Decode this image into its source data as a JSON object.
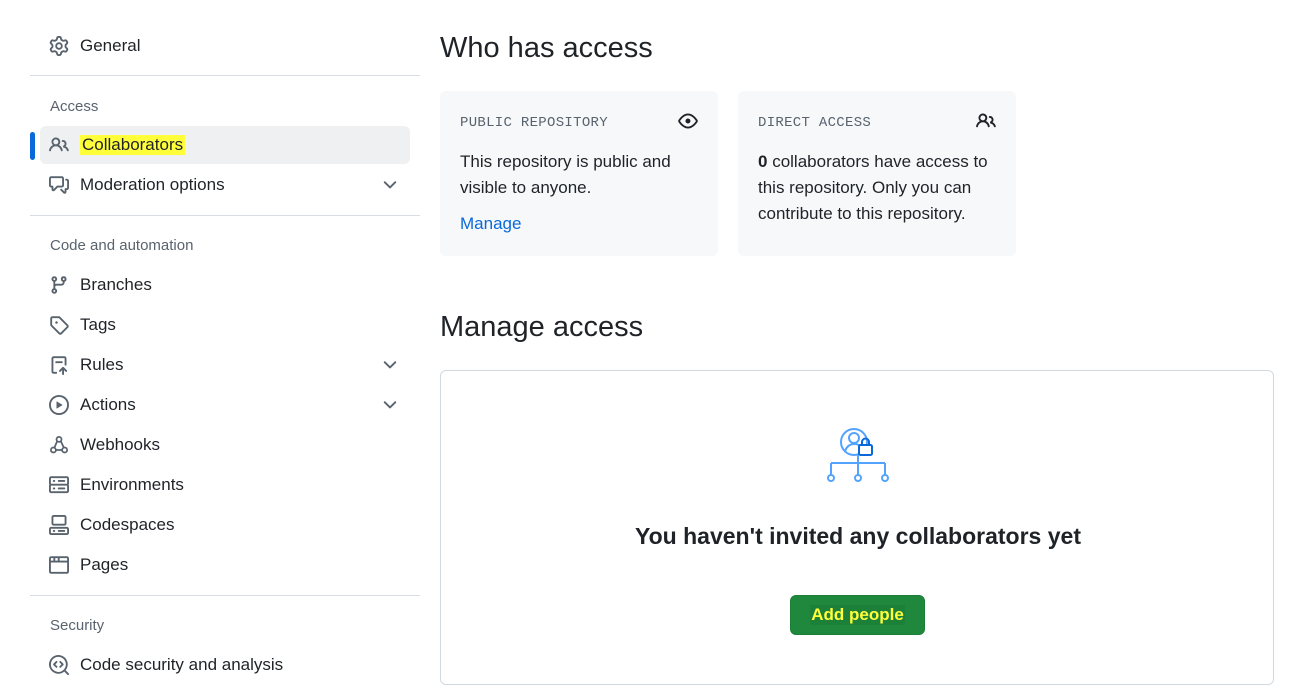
{
  "sidebar": {
    "general": "General",
    "sections": [
      {
        "label": "Access"
      },
      {
        "label": "Code and automation"
      },
      {
        "label": "Security"
      }
    ],
    "access_items": [
      {
        "label": "Collaborators",
        "icon": "people-icon"
      },
      {
        "label": "Moderation options",
        "icon": "comment-discussion-icon"
      }
    ],
    "automation_items": [
      {
        "label": "Branches",
        "icon": "git-branch-icon"
      },
      {
        "label": "Tags",
        "icon": "tag-icon"
      },
      {
        "label": "Rules",
        "icon": "rules-icon"
      },
      {
        "label": "Actions",
        "icon": "play-icon"
      },
      {
        "label": "Webhooks",
        "icon": "webhook-icon"
      },
      {
        "label": "Environments",
        "icon": "server-icon"
      },
      {
        "label": "Codespaces",
        "icon": "codespaces-icon"
      },
      {
        "label": "Pages",
        "icon": "browser-icon"
      }
    ],
    "security_items": [
      {
        "label": "Code security and analysis",
        "icon": "codescan-icon"
      }
    ]
  },
  "main": {
    "who_title": "Who has access",
    "public_card": {
      "title": "PUBLIC REPOSITORY",
      "body": "This repository is public and visible to anyone.",
      "link": "Manage"
    },
    "direct_card": {
      "title": "DIRECT ACCESS",
      "count": "0",
      "body": " collaborators have access to this repository. Only you can contribute to this repository."
    },
    "manage_title": "Manage access",
    "empty_title": "You haven't invited any collaborators yet",
    "add_button": "Add people"
  },
  "colors": {
    "accent": "#0969da",
    "primary_button": "#1f883d",
    "highlight": "#ffff3a"
  }
}
